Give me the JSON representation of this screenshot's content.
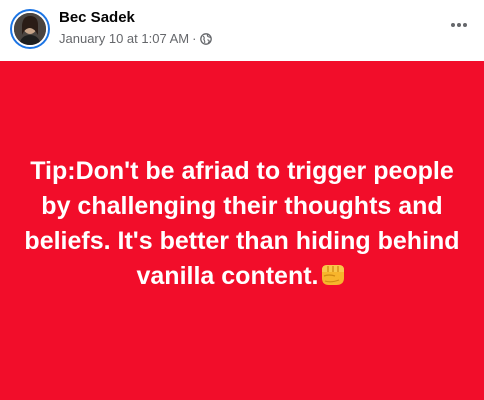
{
  "post": {
    "author": "Bec Sadek",
    "timestamp": "January 10 at 1:07 AM",
    "separator": "·",
    "audience_icon": "globe-icon",
    "menu_icon": "more-options-icon",
    "background_color": "#f20d2a",
    "text": "Tip:Don't be afriad to trigger people by challenging their thoughts and beliefs. It's better than hiding behind vanilla content.",
    "emoji": "👊",
    "emoji_icon": "oncoming-fist-icon"
  }
}
